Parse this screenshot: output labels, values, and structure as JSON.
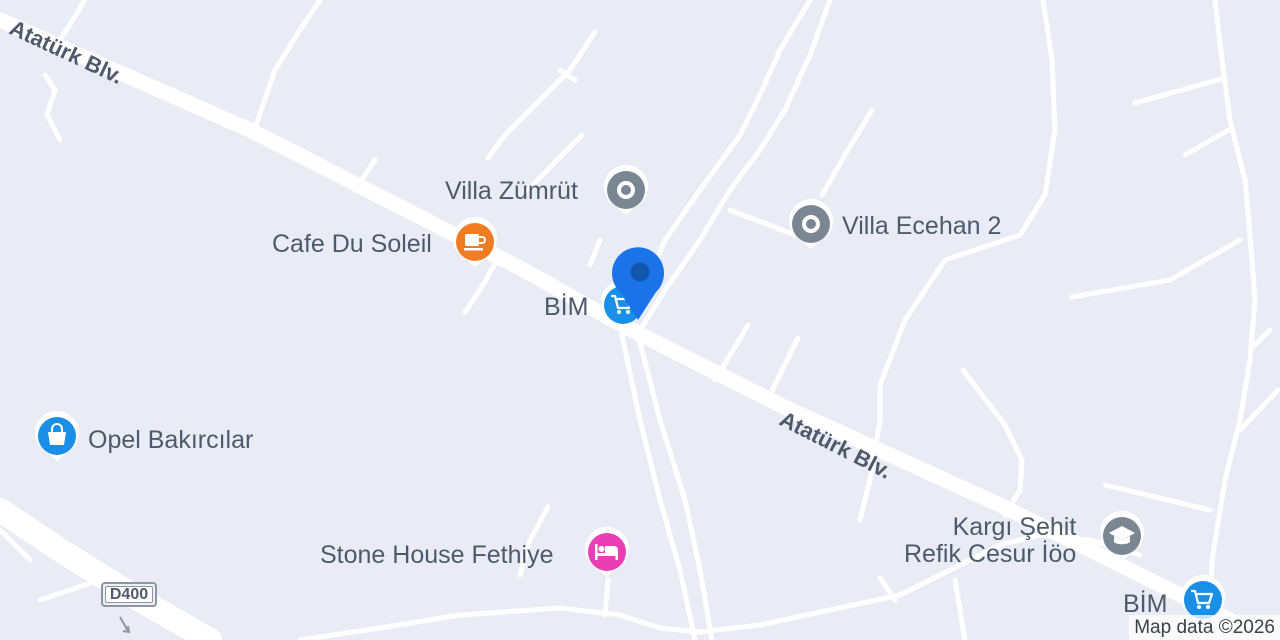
{
  "map": {
    "roads": {
      "main_road_name": "Atatürk Blv.",
      "route_shield": "D400"
    },
    "pois": [
      {
        "name": "Villa Zümrüt",
        "icon": "pin-icon",
        "color": "#7a8793"
      },
      {
        "name": "Cafe Du Soleil",
        "icon": "cafe-icon",
        "color": "#f27c22"
      },
      {
        "name": "Villa Ecehan 2",
        "icon": "pin-icon",
        "color": "#7a8793"
      },
      {
        "name": "BİM",
        "icon": "shopping-cart-icon",
        "color": "#1a8fe8"
      },
      {
        "name": "Opel Bakırcılar",
        "icon": "shopping-bag-icon",
        "color": "#1a8fe8"
      },
      {
        "name": "Stone House Fethiye",
        "icon": "bed-icon",
        "color": "#ea3fb4"
      },
      {
        "name": "Kargı Şehit\nRefik Cesur İöo",
        "icon": "school-icon",
        "color": "#7a8793"
      },
      {
        "name": "BİM",
        "icon": "shopping-cart-icon",
        "color": "#1a8fe8"
      }
    ],
    "location_marker": {
      "icon": "location-marker-icon",
      "color": "#1a73e8"
    },
    "attribution": "Map data ©2026"
  }
}
